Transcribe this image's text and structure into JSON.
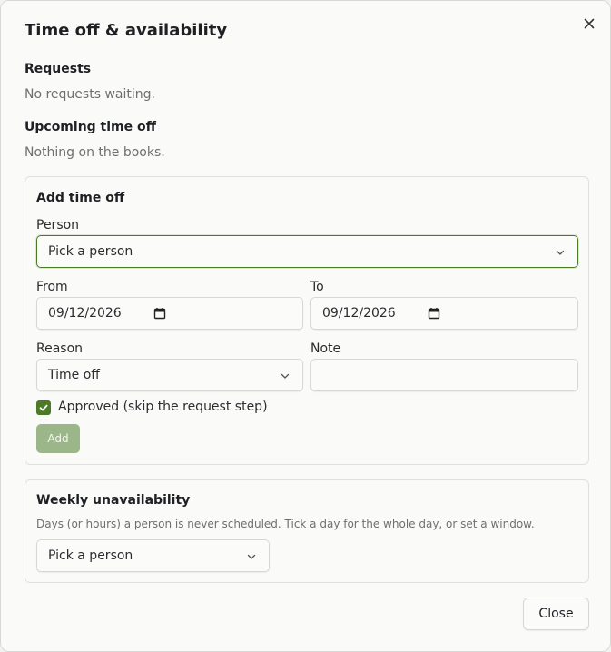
{
  "dialog": {
    "title": "Time off & availability",
    "close_icon": "close-icon"
  },
  "requests": {
    "title": "Requests",
    "empty": "No requests waiting."
  },
  "upcoming": {
    "title": "Upcoming time off",
    "empty": "Nothing on the books."
  },
  "add_time_off": {
    "title": "Add time off",
    "person_label": "Person",
    "person_value": "Pick a person",
    "from_label": "From",
    "from_value": "09/12/2026",
    "to_label": "To",
    "to_value": "09/12/2026",
    "reason_label": "Reason",
    "reason_value": "Time off",
    "note_label": "Note",
    "note_value": "",
    "approved_label": "Approved (skip the request step)",
    "approved_checked": true,
    "add_label": "Add",
    "accent_color": "#4c7a26",
    "add_button_color": "#9bb789"
  },
  "weekly": {
    "title": "Weekly unavailability",
    "hint": "Days (or hours) a person is never scheduled. Tick a day for the whole day, or set a window.",
    "person_value": "Pick a person"
  },
  "footer": {
    "close_label": "Close"
  }
}
